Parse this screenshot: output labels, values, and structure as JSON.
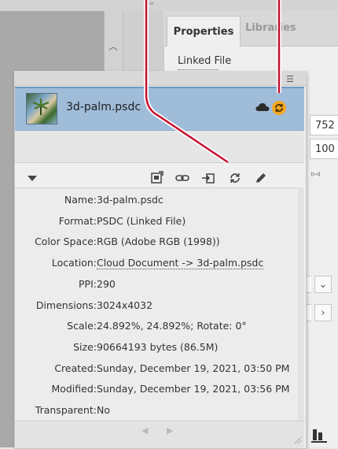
{
  "background_panel": {
    "tabs": [
      {
        "label": "Properties",
        "active": true
      },
      {
        "label": "Libraries",
        "active": false
      }
    ],
    "section_heading": "Linked File",
    "fields": {
      "width_value": "752",
      "height_value": "100"
    }
  },
  "links_panel": {
    "selected_item": {
      "filename": "3d-palm.psdc",
      "cloud_icon": "cloud-icon",
      "sync_icon": "sync-icon"
    },
    "toolbar_icons": [
      "relink-icon",
      "go-to-link-icon",
      "embed-link-icon",
      "update-link-icon",
      "edit-original-icon"
    ],
    "info": [
      {
        "label": "Name:",
        "value": "3d-palm.psdc"
      },
      {
        "label": "Format:",
        "value": "PSDC (Linked File)"
      },
      {
        "label": "Color Space:",
        "value": "RGB (Adobe RGB (1998))"
      },
      {
        "label": "Location:",
        "value": "Cloud Document -> 3d-palm.psdc"
      },
      {
        "label": "PPI:",
        "value": "290"
      },
      {
        "label": "Dimensions:",
        "value": "3024x4032"
      },
      {
        "label": "Scale:",
        "value": "24.892%, 24.892%; Rotate: 0°"
      },
      {
        "label": "Size:",
        "value": "90664193 bytes (86.5M)"
      },
      {
        "label": "Created:",
        "value": "Sunday, December 19, 2021, 03:50 PM"
      },
      {
        "label": "Modified:",
        "value": "Sunday, December 19, 2021, 03:56 PM"
      },
      {
        "label": "Transparent:",
        "value": "No"
      }
    ]
  },
  "colors": {
    "selection": "#9fbcd9",
    "callout": "#c8102e",
    "sync_badge": "#f5a623"
  }
}
